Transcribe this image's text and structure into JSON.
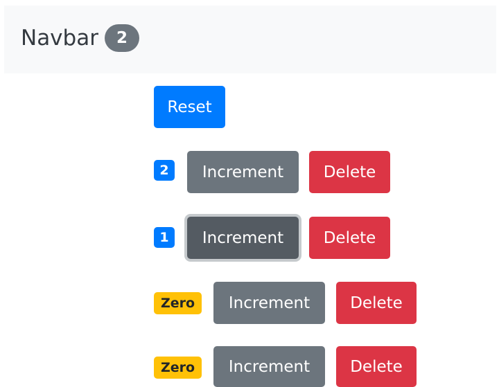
{
  "navbar": {
    "brand": "Navbar",
    "total_count": "2"
  },
  "reset_button": {
    "label": "Reset"
  },
  "counters": [
    {
      "badge": "2",
      "badge_variant": "primary",
      "increment_label": "Increment",
      "delete_label": "Delete"
    },
    {
      "badge": "1",
      "badge_variant": "primary",
      "increment_label": "Increment",
      "delete_label": "Delete",
      "focused": true
    },
    {
      "badge": "Zero",
      "badge_variant": "warning",
      "increment_label": "Increment",
      "delete_label": "Delete"
    },
    {
      "badge": "Zero",
      "badge_variant": "warning",
      "increment_label": "Increment",
      "delete_label": "Delete"
    }
  ],
  "colors": {
    "primary": "#007bff",
    "secondary": "#6c757d",
    "danger": "#dc3545",
    "warning": "#ffc107",
    "navbar_bg": "#f8f9fa"
  }
}
